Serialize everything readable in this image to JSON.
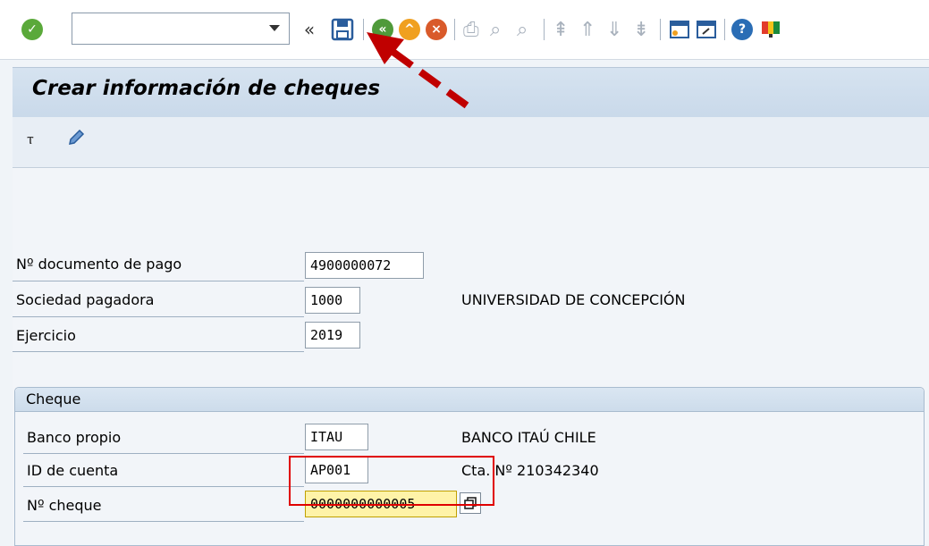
{
  "toolbar": {
    "command_field_value": "",
    "icons": [
      "enter-check",
      "command-dropdown",
      "collapse",
      "save",
      "back",
      "exit",
      "cancel",
      "print",
      "find",
      "find-next",
      "first-page",
      "previous-page",
      "next-page",
      "last-page",
      "create-session",
      "shortcut",
      "help",
      "customize-layout"
    ]
  },
  "title": "Crear información de cheques",
  "fields": {
    "doc_label": "Nº documento de pago",
    "doc_value": "4900000072",
    "soc_label": "Sociedad pagadora",
    "soc_value": "1000",
    "soc_text": "UNIVERSIDAD DE CONCEPCIÓN",
    "ej_label": "Ejercicio",
    "ej_value": "2019"
  },
  "group": {
    "title": "Cheque",
    "banco_label": "Banco propio",
    "banco_value": "ITAU",
    "banco_text": "BANCO ITAÚ CHILE",
    "cuenta_label": "ID de cuenta",
    "cuenta_value": "AP001",
    "cuenta_text": "Cta. Nº 210342340",
    "cheque_label": "Nº cheque",
    "cheque_value": "0000000000005"
  },
  "colors": {
    "accent_red": "#e00000",
    "annotation_red": "#c00000",
    "highlight": "#fff3a8"
  }
}
